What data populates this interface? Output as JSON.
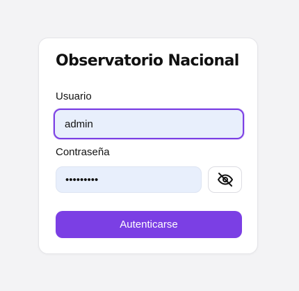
{
  "login_card": {
    "title": "Observatorio Nacional",
    "username": {
      "label": "Usuario",
      "value": "admin"
    },
    "password": {
      "label": "Contraseña",
      "value": "123456789"
    },
    "toggle_visibility_icon": "eye-off-icon",
    "submit_label": "Autenticarse"
  },
  "colors": {
    "accent": "#7b3fe4",
    "input_background": "#e8effc",
    "page_background": "#f3f3f5"
  }
}
